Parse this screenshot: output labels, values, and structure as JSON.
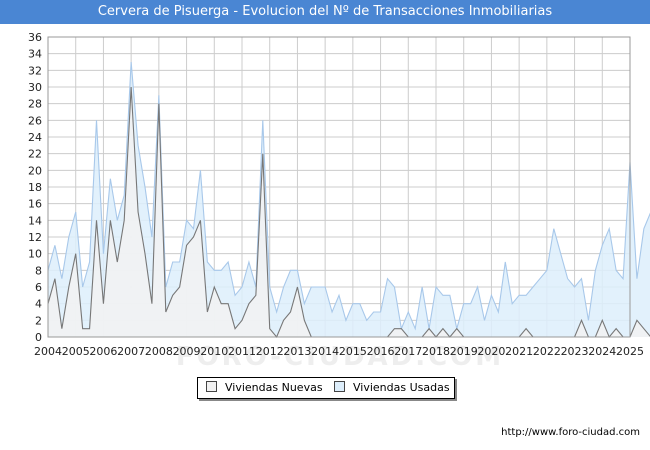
{
  "title": "Cervera de Pisuerga - Evolucion del Nº de Transacciones Inmobiliarias",
  "footer_url": "http://www.foro-ciudad.com",
  "watermark": "FORO-CIUDAD.COM",
  "colors": {
    "title_bg": "#4a86d3",
    "nuevas_line": "#777777",
    "nuevas_fill": "#f2f2f2",
    "usadas_line": "#a8c8ea",
    "usadas_fill": "#ddeefb",
    "grid": "#cccccc"
  },
  "chart_data": {
    "type": "area",
    "ylim": [
      0,
      36
    ],
    "yticks": [
      0,
      2,
      4,
      6,
      8,
      10,
      12,
      14,
      16,
      18,
      20,
      22,
      24,
      26,
      28,
      30,
      32,
      34,
      36
    ],
    "xlim": [
      2004,
      2025
    ],
    "x_tick_labels": [
      "2004",
      "2005",
      "2006",
      "2007",
      "2008",
      "2009",
      "2010",
      "2011",
      "2012",
      "2013",
      "2014",
      "2015",
      "2016",
      "2017",
      "2018",
      "2019",
      "2020",
      "2021",
      "2022",
      "2023",
      "2024",
      "2025"
    ],
    "x_quarters_start": "2004-Q1",
    "series": [
      {
        "name": "Viviendas Nuevas",
        "values": [
          4,
          7,
          1,
          6,
          10,
          1,
          1,
          14,
          4,
          14,
          9,
          14,
          30,
          15,
          10,
          4,
          28,
          3,
          5,
          6,
          11,
          12,
          14,
          3,
          6,
          4,
          4,
          1,
          2,
          4,
          5,
          22,
          1,
          0,
          2,
          3,
          6,
          2,
          0,
          0,
          0,
          0,
          0,
          0,
          0,
          0,
          0,
          0,
          0,
          0,
          1,
          1,
          0,
          0,
          0,
          1,
          0,
          1,
          0,
          1,
          0,
          0,
          0,
          0,
          0,
          0,
          0,
          0,
          0,
          1,
          0,
          0,
          0,
          0,
          0,
          0,
          0,
          2,
          0,
          0,
          2,
          0,
          1,
          0,
          0,
          2,
          1,
          0,
          1,
          3,
          0
        ]
      },
      {
        "name": "Viviendas Usadas",
        "values": [
          8,
          11,
          7,
          12,
          15,
          6,
          9,
          26,
          10,
          19,
          14,
          17,
          33,
          23,
          18,
          12,
          29,
          6,
          9,
          9,
          14,
          13,
          20,
          9,
          8,
          8,
          9,
          5,
          6,
          9,
          6,
          26,
          6,
          3,
          6,
          8,
          8,
          4,
          6,
          6,
          6,
          3,
          5,
          2,
          4,
          4,
          2,
          3,
          3,
          7,
          6,
          1,
          3,
          1,
          6,
          1,
          6,
          5,
          5,
          1,
          4,
          4,
          6,
          2,
          5,
          3,
          9,
          4,
          5,
          5,
          6,
          7,
          8,
          13,
          10,
          7,
          6,
          7,
          2,
          8,
          11,
          13,
          8,
          7,
          21,
          7,
          13,
          15
        ]
      }
    ]
  }
}
